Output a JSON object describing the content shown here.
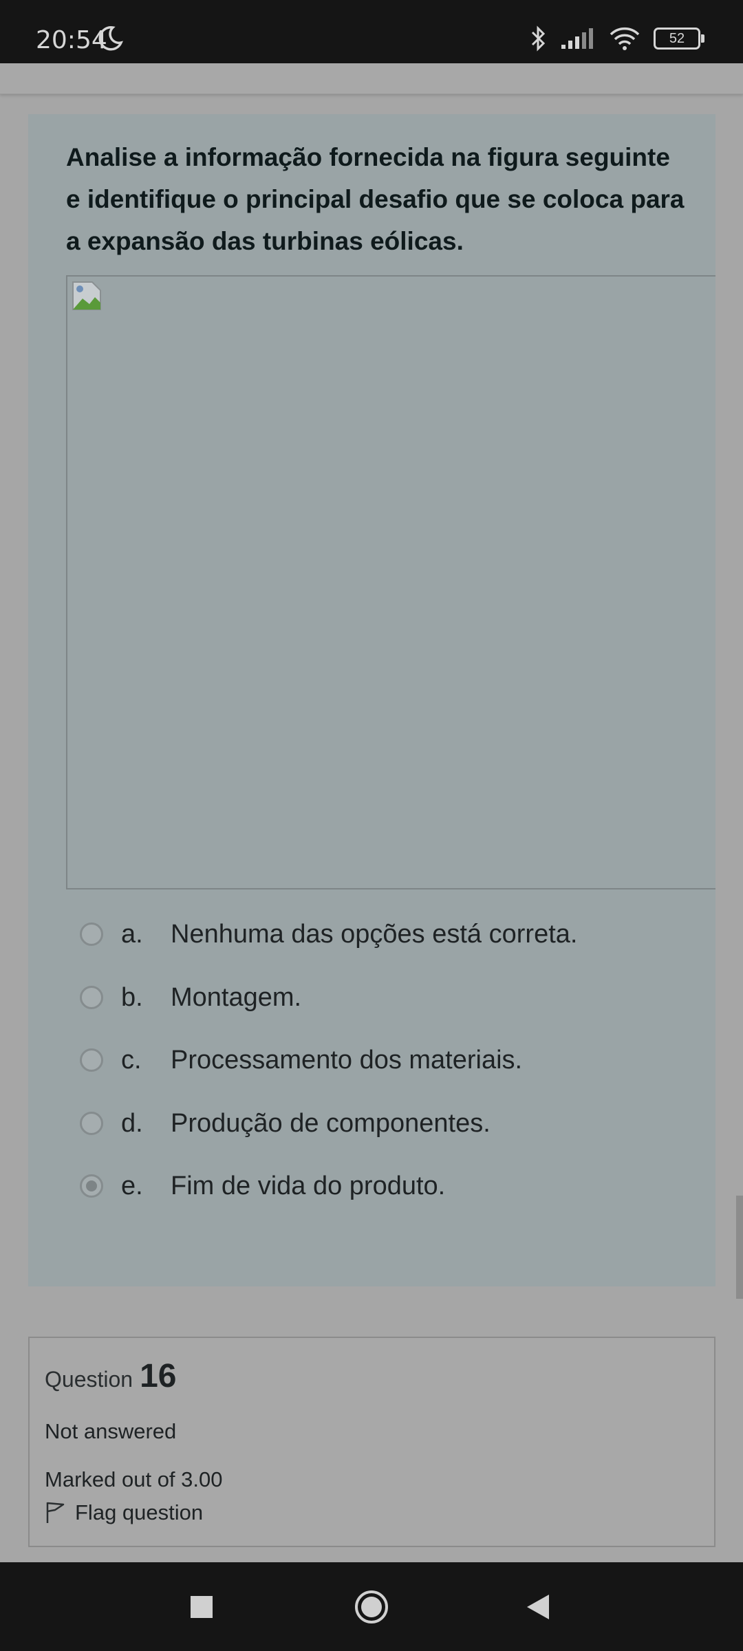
{
  "status_bar": {
    "time": "20:54",
    "battery": "52",
    "icons": [
      "moon-icon",
      "bluetooth-icon",
      "signal-icon",
      "wifi-icon",
      "battery-icon"
    ]
  },
  "question": {
    "text": "Analise a informação fornecida na figura seguinte e identifique o principal desafio que se coloca para a expansão das turbinas eólicas.",
    "options": [
      {
        "letter": "a.",
        "text": "Nenhuma das opções está correta.",
        "selected": false
      },
      {
        "letter": "b.",
        "text": "Montagem.",
        "selected": false
      },
      {
        "letter": "c.",
        "text": "Processamento dos materiais.",
        "selected": false
      },
      {
        "letter": "d.",
        "text": "Produção de componentes.",
        "selected": false
      },
      {
        "letter": "e.",
        "text": "Fim de vida do produto.",
        "selected": true
      }
    ]
  },
  "info": {
    "question_label": "Question",
    "question_number": "16",
    "status": "Not answered",
    "marks": "Marked out of 3.00",
    "flag_label": "Flag question"
  },
  "colors": {
    "card_bg": "#9aa4a6",
    "page_bg": "#a6a6a6",
    "system_bars": "#151515"
  }
}
